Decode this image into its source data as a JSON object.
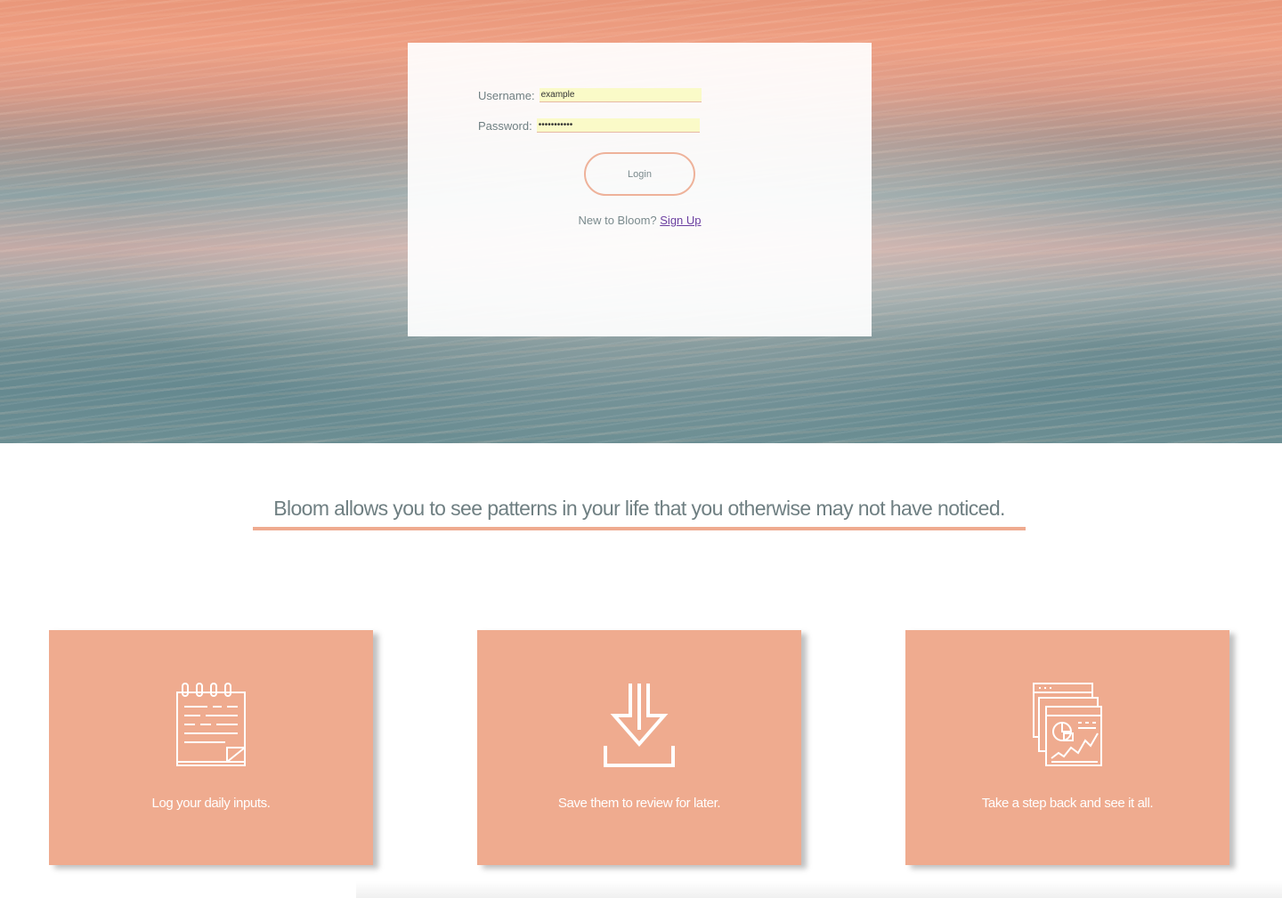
{
  "login": {
    "username_label": "Username:",
    "username_value": "example",
    "password_label": "Password:",
    "password_value": "•••••••••••",
    "login_button": "Login",
    "signup_prompt": "New to Bloom?",
    "signup_link": "Sign Up"
  },
  "tagline": "Bloom allows you to see patterns in your life that you otherwise may not have noticed.",
  "features": [
    {
      "icon": "notepad-icon",
      "text": "Log your daily inputs."
    },
    {
      "icon": "download-icon",
      "text": "Save them to review for later."
    },
    {
      "icon": "dashboard-chart-icon",
      "text": "Take a step back and see it all."
    }
  ],
  "colors": {
    "accent": "#efab8f",
    "text": "#6f7f82",
    "link": "#6b3fa0",
    "autofill": "#fafac8"
  }
}
